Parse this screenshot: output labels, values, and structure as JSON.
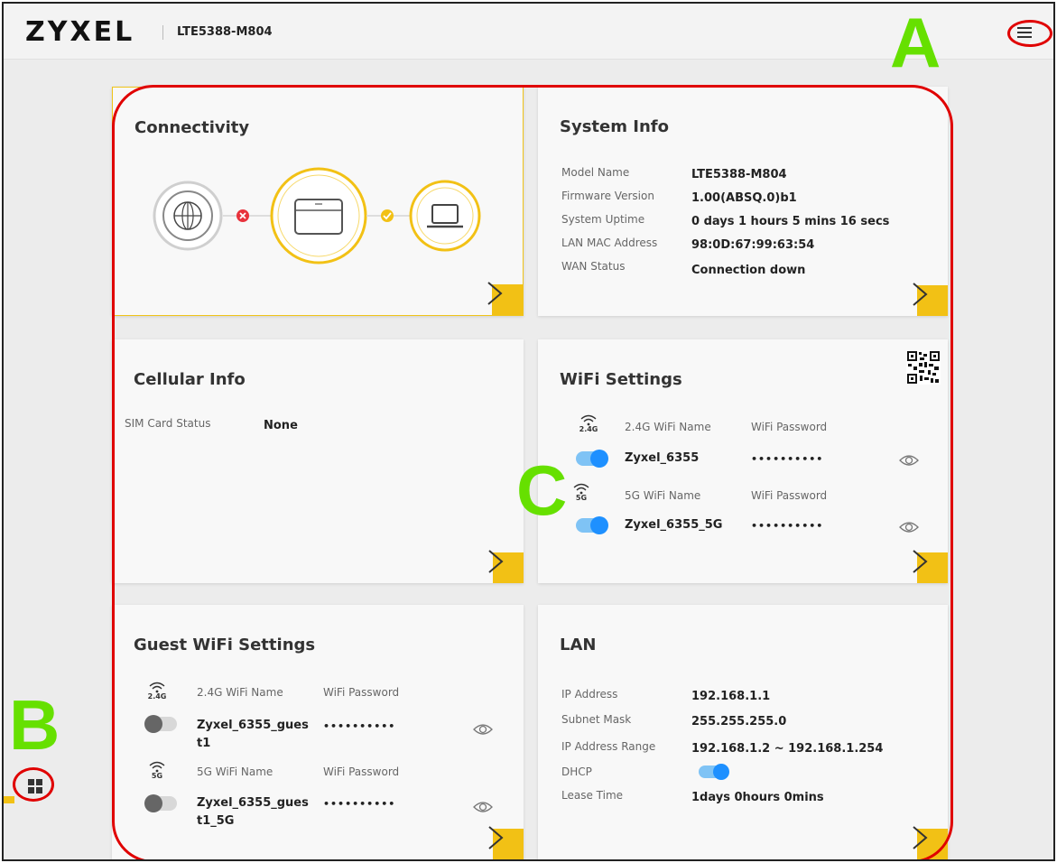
{
  "header": {
    "brand": "ZYXEL",
    "model": "LTE5388-M804"
  },
  "callouts": {
    "a": "A",
    "b": "B",
    "c": "C"
  },
  "colors": {
    "accent": "#f2c115",
    "toggle_on": "#1e90ff",
    "callout_ring": "#e00000",
    "callout_letter": "#66e000",
    "error": "#e8323c"
  },
  "icons": {
    "menu": "hamburger-menu-icon",
    "dashboard": "grid-icon",
    "internet": "globe-icon",
    "router": "router-icon",
    "client": "laptop-icon",
    "link_down": "error-x-icon",
    "link_up": "check-icon",
    "qr": "qr-code-icon",
    "wifi": "wifi-icon",
    "reveal": "eye-icon",
    "next": "chevron-right-icon"
  },
  "connectivity": {
    "title": "Connectivity"
  },
  "system_info": {
    "title": "System Info",
    "rows": [
      {
        "label": "Model Name",
        "value": "LTE5388-M804"
      },
      {
        "label": "Firmware Version",
        "value": "1.00(ABSQ.0)b1"
      },
      {
        "label": "System Uptime",
        "value": "0 days 1 hours 5 mins 16 secs"
      },
      {
        "label": "LAN MAC Address",
        "value": "98:0D:67:99:63:54"
      },
      {
        "label": "WAN Status",
        "value": "Connection down"
      }
    ]
  },
  "cellular_info": {
    "title": "Cellular Info",
    "sim_label": "SIM Card Status",
    "sim_value": "None"
  },
  "wifi_settings": {
    "title": "WiFi Settings",
    "band24": {
      "badge": "2.4G",
      "name_label": "2.4G WiFi Name",
      "pass_label": "WiFi Password",
      "name": "Zyxel_6355",
      "password": "••••••••••",
      "enabled": true
    },
    "band5": {
      "badge": "5G",
      "name_label": "5G WiFi Name",
      "pass_label": "WiFi Password",
      "name": "Zyxel_6355_5G",
      "password": "••••••••••",
      "enabled": true
    }
  },
  "guest_wifi": {
    "title": "Guest WiFi Settings",
    "band24": {
      "badge": "2.4G",
      "name_label": "2.4G WiFi Name",
      "pass_label": "WiFi Password",
      "name_line1": "Zyxel_6355_gues",
      "name_line2": "t1",
      "password": "••••••••••",
      "enabled": false
    },
    "band5": {
      "badge": "5G",
      "name_label": "5G WiFi Name",
      "pass_label": "WiFi Password",
      "name_line1": "Zyxel_6355_gues",
      "name_line2": "t1_5G",
      "password": "••••••••••",
      "enabled": false
    }
  },
  "lan": {
    "title": "LAN",
    "ip_label": "IP Address",
    "ip": "192.168.1.1",
    "mask_label": "Subnet Mask",
    "mask": "255.255.255.0",
    "range_label": "IP Address Range",
    "range": "192.168.1.2 ~ 192.168.1.254",
    "dhcp_label": "DHCP",
    "dhcp_enabled": true,
    "lease_label": "Lease Time",
    "lease": "1days 0hours 0mins"
  }
}
